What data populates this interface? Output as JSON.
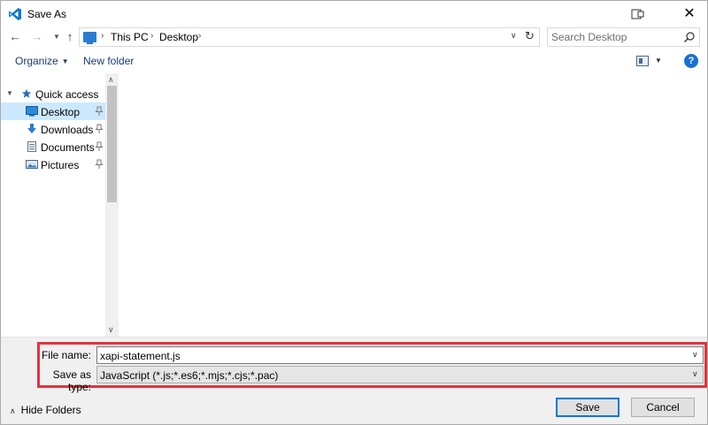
{
  "window": {
    "title": "Save As",
    "close_glyph": "✕"
  },
  "address": {
    "crumbs": [
      "This PC",
      "Desktop"
    ],
    "separator": "›",
    "search_placeholder": "Search Desktop"
  },
  "toolbar": {
    "organize_label": "Organize",
    "new_folder_label": "New folder",
    "help_label": "?"
  },
  "nav_pane": {
    "quick_access_label": "Quick access",
    "items": [
      {
        "label": "Desktop",
        "icon": "desktop-icon",
        "pinned": true,
        "selected": true
      },
      {
        "label": "Downloads",
        "icon": "downloads-icon",
        "pinned": true,
        "selected": false
      },
      {
        "label": "Documents",
        "icon": "documents-icon",
        "pinned": true,
        "selected": false
      },
      {
        "label": "Pictures",
        "icon": "pictures-icon",
        "pinned": true,
        "selected": false
      }
    ]
  },
  "form": {
    "file_name_label": "File name:",
    "file_name_value": "xapi-statement.js",
    "save_as_type_label": "Save as type:",
    "save_as_type_value": "JavaScript (*.js;*.es6;*.mjs;*.cjs;*.pac)"
  },
  "footer": {
    "hide_folders_label": "Hide Folders",
    "save_label": "Save",
    "cancel_label": "Cancel"
  },
  "colors": {
    "accent": "#0078d7",
    "selection": "#cce8ff",
    "highlight_border": "#e0343f"
  }
}
